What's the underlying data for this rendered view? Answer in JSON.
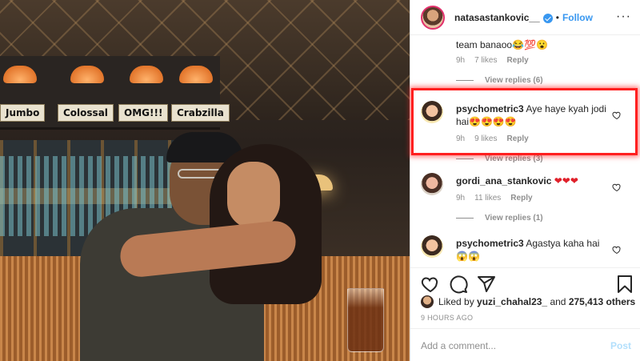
{
  "post": {
    "username": "natasastankovic__",
    "dot": "•",
    "follow_label": "Follow",
    "more_label": "···",
    "photo_signs": [
      "Jumbo",
      "Colossal",
      "OMG!!!",
      "Crabzilla"
    ]
  },
  "comments": [
    {
      "id": "c0",
      "text": "team banaoo😂💯😮",
      "time": "9h",
      "likes": "7 likes",
      "reply_label": "Reply",
      "view_replies": "View replies (6)"
    },
    {
      "id": "c1",
      "username": "psychometric3",
      "text": "Aye haye kyah jodi hai😍😍😍😍",
      "time": "9h",
      "likes": "9 likes",
      "reply_label": "Reply",
      "view_replies": "View replies (3)",
      "highlighted": true
    },
    {
      "id": "c2",
      "username": "gordi_ana_stankovic",
      "text": "❤❤❤",
      "time": "9h",
      "likes": "11 likes",
      "reply_label": "Reply",
      "view_replies": "View replies (1)"
    },
    {
      "id": "c3",
      "username": "psychometric3",
      "text": "Agastya kaha hai",
      "text2": "😱😱"
    }
  ],
  "likes": {
    "prefix": "Liked by",
    "user": "yuzi_chahal23_",
    "middle": "and",
    "count": "275,413 others"
  },
  "timestamp": "9 HOURS AGO",
  "add_comment": {
    "placeholder": "Add a comment...",
    "post_label": "Post"
  },
  "colors": {
    "accent": "#3897f0",
    "highlight": "#ff1f1f",
    "muted": "#8e8e8e"
  },
  "icons": [
    "verified-icon",
    "heart-icon",
    "comment-icon",
    "share-icon",
    "bookmark-icon",
    "more-icon"
  ]
}
